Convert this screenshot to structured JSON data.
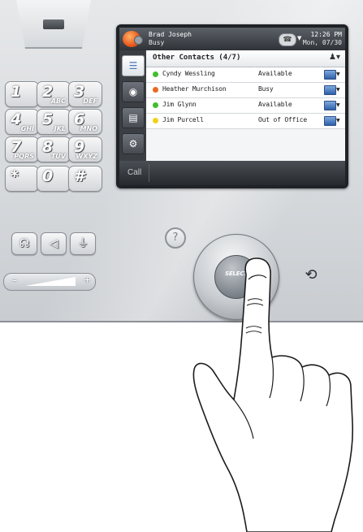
{
  "status_bar": {
    "user_name": "Brad Joseph",
    "user_status": "Busy",
    "time": "12:26 PM",
    "date": "Mon, 07/30"
  },
  "contact_list": {
    "group_title": "Other Contacts (4/7)",
    "contacts": [
      {
        "name": "Cyndy Wessling",
        "availability": "Available",
        "presence_color": "#3fbf2e"
      },
      {
        "name": "Heather Murchison",
        "availability": "Busy",
        "presence_color": "#e86a1e"
      },
      {
        "name": "Jim Glynn",
        "availability": "Available",
        "presence_color": "#3fbf2e"
      },
      {
        "name": "Jim Purcell",
        "availability": "Out of Office",
        "presence_color": "#f2d11b"
      }
    ]
  },
  "softkeys": {
    "call": "Call"
  },
  "keypad": [
    {
      "digit": "1",
      "letters": ""
    },
    {
      "digit": "2",
      "letters": "ABC"
    },
    {
      "digit": "3",
      "letters": "DEF"
    },
    {
      "digit": "4",
      "letters": "GHI"
    },
    {
      "digit": "5",
      "letters": "JKL"
    },
    {
      "digit": "6",
      "letters": "MNO"
    },
    {
      "digit": "7",
      "letters": "PQRS"
    },
    {
      "digit": "8",
      "letters": "TUV"
    },
    {
      "digit": "9",
      "letters": "WXYZ"
    },
    {
      "digit": "*",
      "letters": ""
    },
    {
      "digit": "0",
      "letters": ""
    },
    {
      "digit": "#",
      "letters": ""
    }
  ],
  "volume": {
    "minus": "–",
    "plus": "+"
  },
  "help": {
    "label": "?"
  },
  "select_button": {
    "label": "SELECT"
  },
  "icons": {
    "headset": "headset-icon",
    "speaker": "speaker-icon",
    "mute": "mute-icon",
    "back": "back-icon"
  }
}
